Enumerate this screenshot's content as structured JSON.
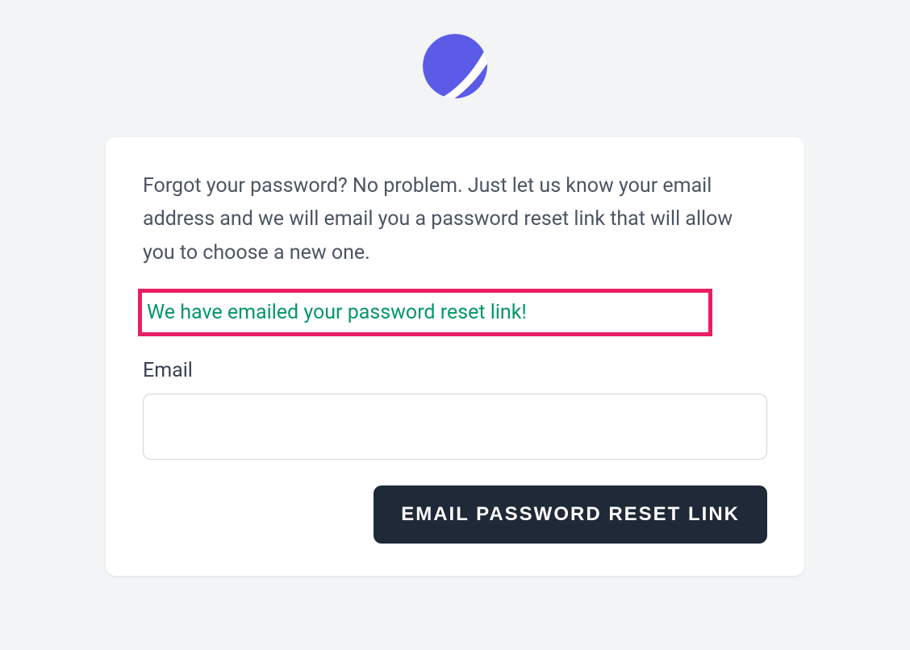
{
  "card": {
    "description": "Forgot your password? No problem. Just let us know your email address and we will email you a password reset link that will allow you to choose a new one.",
    "status_message": "We have emailed your password reset link!",
    "email_label": "Email",
    "email_value": "",
    "submit_label": "EMAIL PASSWORD RESET LINK"
  }
}
